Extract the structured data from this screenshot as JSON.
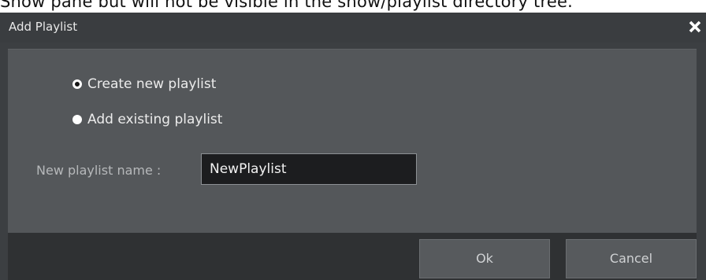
{
  "background_caption": "Show pane but will not be visible in the show/playlist directory tree.",
  "dialog": {
    "title": "Add Playlist",
    "close_icon": "close-icon",
    "options": [
      {
        "label": "Create new playlist",
        "selected": true
      },
      {
        "label": "Add existing playlist",
        "selected": false
      }
    ],
    "name_field": {
      "label": "New playlist name :",
      "value": "NewPlaylist"
    },
    "buttons": {
      "ok": "Ok",
      "cancel": "Cancel"
    }
  },
  "colors": {
    "dialog_bg": "#3c3f42",
    "content_bg": "#54575a",
    "footer_bg": "#2f3133",
    "input_bg": "#1c1d1f"
  }
}
